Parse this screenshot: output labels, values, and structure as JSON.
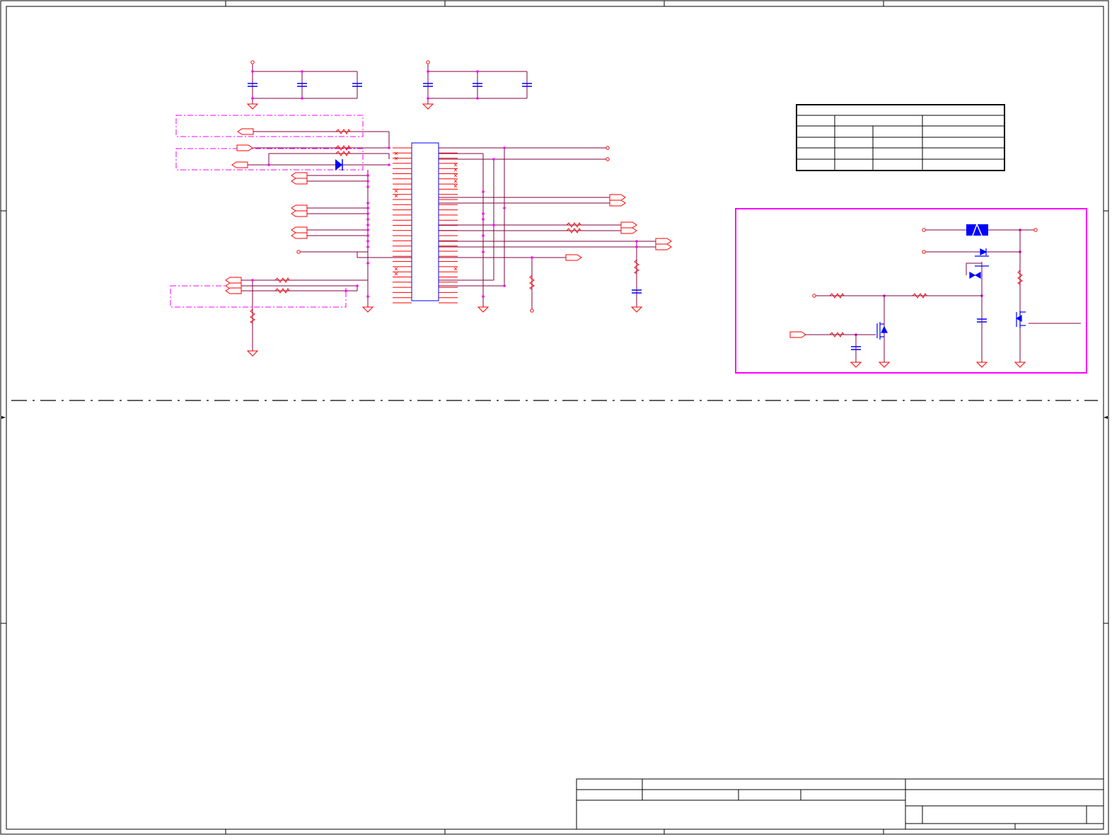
{
  "sheet": {
    "title_block": {
      "title": "",
      "size": "",
      "document_number": "",
      "revision": "",
      "date": "",
      "sheet_of": ""
    },
    "zone_markers": [
      "",
      "",
      "",
      ""
    ]
  },
  "colors": {
    "wire": "#800040",
    "pin": "#ff0000",
    "component": "#0000ff",
    "highlight_box": "#ff00ff",
    "frame": "#000000",
    "junction": "#ff00ff"
  },
  "schematic": {
    "connector_pin_count": 31,
    "table": {
      "rows": 5,
      "columns": 4
    },
    "symbols": [
      "capacitor-icon",
      "resistor-icon",
      "ground-icon",
      "power-port-icon",
      "off-page-connector-icon",
      "diode-icon",
      "mosfet-icon",
      "fuse-icon",
      "no-connect-icon"
    ]
  }
}
